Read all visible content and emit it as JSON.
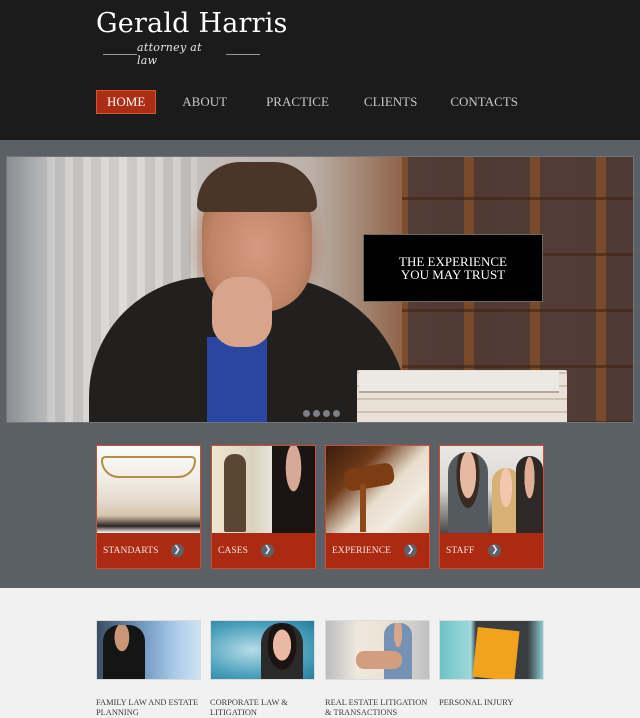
{
  "header": {
    "logo_title": "Gerald Harris",
    "logo_subtitle": "attorney at law"
  },
  "nav": {
    "items": [
      {
        "label": "HOME",
        "active": true
      },
      {
        "label": "ABOUT",
        "active": false
      },
      {
        "label": "PRACTICE",
        "active": false
      },
      {
        "label": "CLIENTS",
        "active": false
      },
      {
        "label": "CONTACTS",
        "active": false
      }
    ]
  },
  "hero": {
    "caption_line1": "THE EXPERIENCE",
    "caption_line2": "YOU MAY TRUST",
    "slide_count": 4,
    "image_description": "lawyer in robe seated with hand at chin beside stack of books"
  },
  "cards": [
    {
      "label": "STANDARTS",
      "icon": "chevron-right-icon",
      "image": "glasses on open book"
    },
    {
      "label": "CASES",
      "icon": "chevron-right-icon",
      "image": "justice statue and woman writing"
    },
    {
      "label": "EXPERIENCE",
      "icon": "chevron-right-icon",
      "image": "gavel on documents"
    },
    {
      "label": "STAFF",
      "icon": "chevron-right-icon",
      "image": "smiling team of professionals"
    }
  ],
  "services": [
    {
      "title_line1": "FAMILY LAW AND ESTATE",
      "title_line2": "PLANNING"
    },
    {
      "title_line1": "CORPORATE LAW &",
      "title_line2": "LITIGATION"
    },
    {
      "title_line1": "REAL ESTATE LITIGATION",
      "title_line2": "& TRANSACTIONS"
    },
    {
      "title_line1": "PERSONAL INJURY",
      "title_line2": ""
    }
  ],
  "colors": {
    "header_bg": "#1c1b1c",
    "accent_red": "#ac2a12",
    "band_slate": "#5b6066",
    "footer_bg": "#f1f1f1"
  }
}
